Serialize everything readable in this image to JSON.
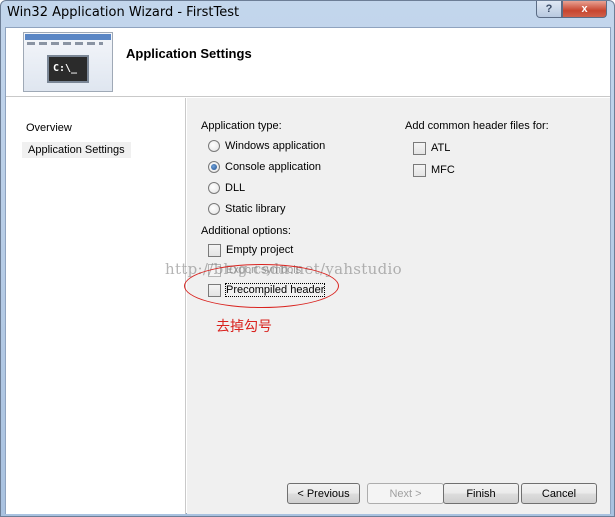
{
  "window": {
    "title": "Win32 Application Wizard - FirstTest",
    "help_glyph": "?",
    "close_glyph": "x"
  },
  "header": {
    "title": "Application Settings",
    "console_text": "C:\\_"
  },
  "sidebar": {
    "items": [
      {
        "label": "Overview"
      },
      {
        "label": "Application Settings"
      }
    ]
  },
  "application_type": {
    "label": "Application type:",
    "options": [
      {
        "label": "Windows application",
        "selected": false
      },
      {
        "label": "Console application",
        "selected": true
      },
      {
        "label": "DLL",
        "selected": false
      },
      {
        "label": "Static library",
        "selected": false
      }
    ]
  },
  "additional_options": {
    "label": "Additional options:",
    "options": [
      {
        "label": "Empty project",
        "checked": false,
        "enabled": true
      },
      {
        "label": "Export symbols",
        "checked": false,
        "enabled": false
      },
      {
        "label": "Precompiled header",
        "checked": false,
        "enabled": true
      }
    ]
  },
  "header_files": {
    "label": "Add common header files for:",
    "options": [
      {
        "label": "ATL",
        "checked": false
      },
      {
        "label": "MFC",
        "checked": false
      }
    ]
  },
  "annotation": {
    "text": "去掉勾号",
    "color": "#d9231f"
  },
  "watermark": "http://blog.csdn.net/yahstudio",
  "buttons": {
    "previous": "< Previous",
    "next": "Next >",
    "finish": "Finish",
    "cancel": "Cancel"
  }
}
